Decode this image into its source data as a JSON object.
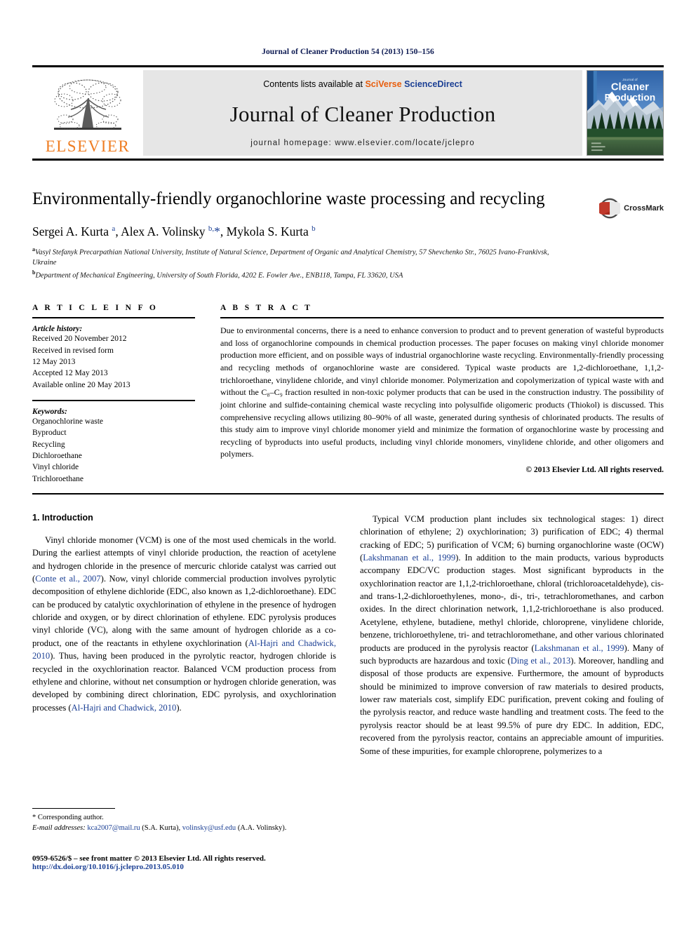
{
  "running_head": "Journal of Cleaner Production 54 (2013) 150–156",
  "masthead": {
    "publisher_name": "ELSEVIER",
    "contents_prefix": "Contents lists available at ",
    "contents_sci": "SciVerse",
    "contents_direct": "ScienceDirect",
    "journal_title": "Journal of Cleaner Production",
    "homepage": "journal homepage: www.elsevier.com/locate/jclepro",
    "cover_line1": "Journal of",
    "cover_line2": "Cleaner",
    "cover_line3": "Production"
  },
  "article": {
    "title": "Environmentally-friendly organochlorine waste processing and recycling",
    "crossmark_label": "CrossMark",
    "authors_html": "Sergei A. Kurta <sup>a</sup>, Alex A. Volinsky <sup>b,</sup><span class=\"star\">*</span>, Mykola S. Kurta <sup>b</sup>",
    "authors_plain": "Sergei A. Kurta a, Alex A. Volinsky b,*, Mykola S. Kurta b",
    "affiliation_a": "Vasyl Stefanyk Precarpathian National University, Institute of Natural Science, Department of Organic and Analytical Chemistry, 57 Shevchenko Str., 76025 Ivano-Frankivsk, Ukraine",
    "affiliation_b": "Department of Mechanical Engineering, University of South Florida, 4202 E. Fowler Ave., ENB118, Tampa, FL 33620, USA"
  },
  "article_info": {
    "heading": "A R T I C L E   I N F O",
    "history_label": "Article history:",
    "history_lines": [
      "Received 20 November 2012",
      "Received in revised form",
      "12 May 2013",
      "Accepted 12 May 2013",
      "Available online 20 May 2013"
    ],
    "keywords_label": "Keywords:",
    "keywords": [
      "Organochlorine waste",
      "Byproduct",
      "Recycling",
      "Dichloroethane",
      "Vinyl chloride",
      "Trichloroethane"
    ]
  },
  "abstract": {
    "heading": "A B S T R A C T",
    "text": "Due to environmental concerns, there is a need to enhance conversion to product and to prevent generation of wasteful byproducts and loss of organochlorine compounds in chemical production processes. The paper focuses on making vinyl chloride monomer production more efficient, and on possible ways of industrial organochlorine waste recycling. Environmentally-friendly processing and recycling methods of organochlorine waste are considered. Typical waste products are 1,2-dichloroethane, 1,1,2-trichloroethane, vinylidene chloride, and vinyl chloride monomer. Polymerization and copolymerization of typical waste with and without the C₈–C₉ fraction resulted in non-toxic polymer products that can be used in the construction industry. The possibility of joint chlorine and sulfide-containing chemical waste recycling into polysulfide oligomeric products (Thiokol) is discussed. This comprehensive recycling allows utilizing 80–90% of all waste, generated during synthesis of chlorinated products. The results of this study aim to improve vinyl chloride monomer yield and minimize the formation of organochlorine waste by processing and recycling of byproducts into useful products, including vinyl chloride monomers, vinylidene chloride, and other oligomers and polymers.",
    "copyright": "© 2013 Elsevier Ltd. All rights reserved."
  },
  "introduction": {
    "section_title": "1. Introduction",
    "left_paragraph_html": "Vinyl chloride monomer (VCM) is one of the most used chemicals in the world. During the earliest attempts of vinyl chloride production, the reaction of acetylene and hydrogen chloride in the presence of mercuric chloride catalyst was carried out (<span class=\"ref\">Conte et al., 2007</span>). Now, vinyl chloride commercial production involves pyrolytic decomposition of ethylene dichloride (EDC, also known as 1,2-dichloroethane). EDC can be produced by catalytic oxychlorination of ethylene in the presence of hydrogen chloride and oxygen, or by direct chlorination of ethylene. EDC pyrolysis produces vinyl chloride (VC), along with the same amount of hydrogen chloride as a co-product, one of the reactants in ethylene oxychlorination (<span class=\"ref\">Al-Hajri and Chadwick, 2010</span>). Thus, having been produced in the pyrolytic reactor, hydrogen chloride is recycled in the oxychlorination reactor. Balanced VCM production process from ethylene and chlorine, without net consumption or hydrogen chloride generation, was developed by combining direct chlorination, EDC pyrolysis, and oxychlorination processes (<span class=\"ref\">Al-Hajri and Chadwick, 2010</span>).",
    "right_paragraph_html": "Typical VCM production plant includes six technological stages: 1) direct chlorination of ethylene; 2) oxychlorination; 3) purification of EDC; 4) thermal cracking of EDC; 5) purification of VCM; 6) burning organochlorine waste (OCW) (<span class=\"ref\">Lakshmanan et al., 1999</span>). In addition to the main products, various byproducts accompany EDC/VC production stages. Most significant byproducts in the oxychlorination reactor are 1,1,2-trichloroethane, chloral (trichloroacetaldehyde), cis- and trans-1,2-dichloroethylenes, mono-, di-, tri-, tetrachloromethanes, and carbon oxides. In the direct chlorination network, 1,1,2-trichloroethane is also produced. Acetylene, ethylene, butadiene, methyl chloride, chloroprene, vinylidene chloride, benzene, trichloroethylene, tri- and tetrachloromethane, and other various chlorinated products are produced in the pyrolysis reactor (<span class=\"ref\">Lakshmanan et al., 1999</span>). Many of such byproducts are hazardous and toxic (<span class=\"ref\">Ding et al., 2013</span>). Moreover, handling and disposal of those products are expensive. Furthermore, the amount of byproducts should be minimized to improve conversion of raw materials to desired products, lower raw materials cost, simplify EDC purification, prevent coking and fouling of the pyrolysis reactor, and reduce waste handling and treatment costs. The feed to the pyrolysis reactor should be at least 99.5% of pure dry EDC. In addition, EDC, recovered from the pyrolysis reactor, contains an appreciable amount of impurities. Some of these impurities, for example chloroprene, polymerizes to a"
  },
  "footnote": {
    "corresponding": "* Corresponding author.",
    "emails_html": "<span class=\"it\">E-mail addresses:</span> <span class=\"link\">kca2007@mail.ru</span> (S.A. Kurta), <span class=\"link\">volinsky@usf.edu</span> (A.A. Volinsky).",
    "email_1": "kca2007@mail.ru",
    "email_1_owner": "(S.A. Kurta)",
    "email_2": "volinsky@usf.edu",
    "email_2_owner": "(A.A. Volinsky)."
  },
  "footer": {
    "issn_line": "0959-6526/$ – see front matter © 2013 Elsevier Ltd. All rights reserved.",
    "doi": "http://dx.doi.org/10.1016/j.jclepro.2013.05.010"
  },
  "colors": {
    "elsevier_orange": "#ef7d22",
    "link_blue": "#1b3f94",
    "running_head_blue": "#0d1a52",
    "masthead_grey": "#e6e6e6"
  }
}
